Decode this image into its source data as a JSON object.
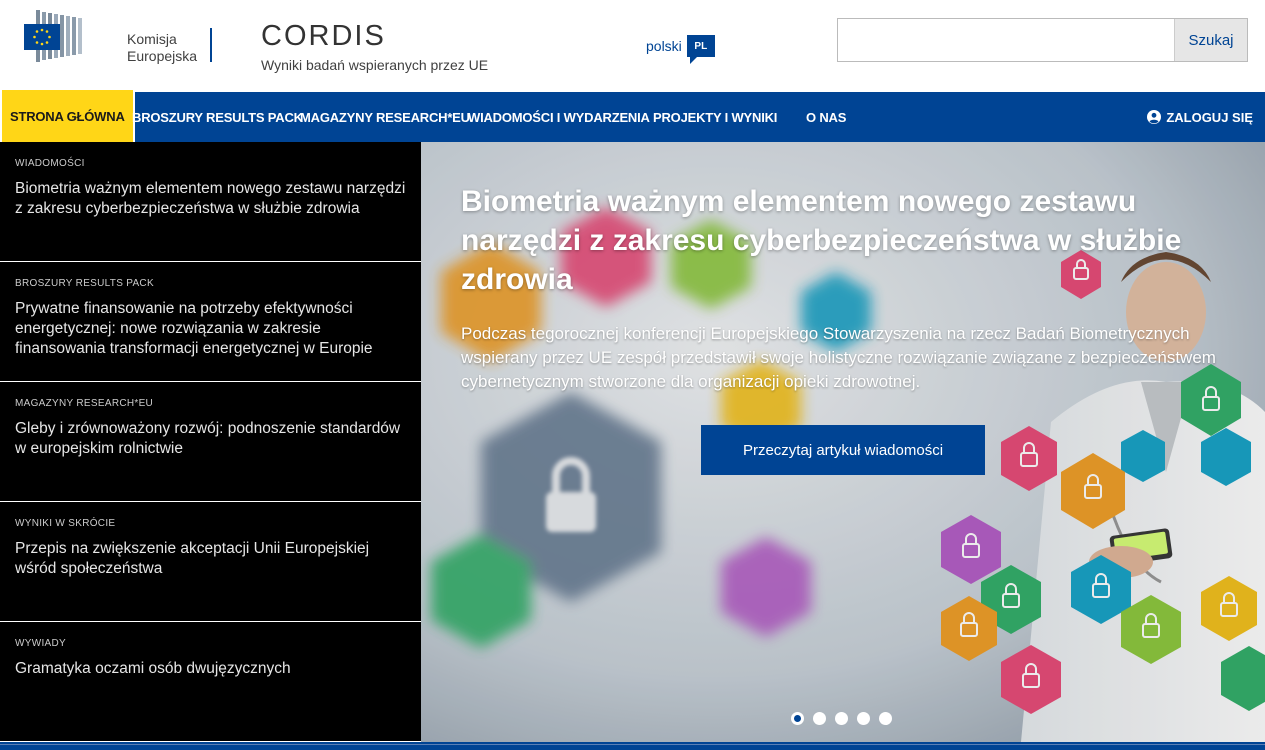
{
  "header": {
    "org_name_line1": "Komisja",
    "org_name_line2": "Europejska",
    "site_name": "CORDIS",
    "site_subtitle": "Wyniki badań wspieranych przez UE",
    "language_label": "polski",
    "language_code": "PL",
    "search": {
      "placeholder": "",
      "value": "",
      "button_label": "Szukaj"
    }
  },
  "nav": {
    "items": [
      {
        "label": "STRONA GŁÓWNA",
        "active": true
      },
      {
        "label": "BROSZURY RESULTS PACK"
      },
      {
        "label": "MAGAZYNY RESEARCH*EU"
      },
      {
        "label": "WIADOMOŚCI I WYDARZENIA"
      },
      {
        "label": "PROJEKTY I WYNIKI"
      },
      {
        "label": "O NAS"
      }
    ],
    "login_label": "ZALOGUJ SIĘ",
    "login_icon": "user-icon"
  },
  "sidebar": {
    "items": [
      {
        "category": "WIADOMOŚCI",
        "title": "Biometria ważnym elementem nowego zestawu narzędzi z zakresu cyberbezpieczeństwa w służbie zdrowia"
      },
      {
        "category": "BROSZURY RESULTS PACK",
        "title": "Prywatne finansowanie na potrzeby efektywności energetycznej: nowe rozwiązania w zakresie finansowania transformacji energetycznej w Europie"
      },
      {
        "category": "MAGAZYNY RESEARCH*EU",
        "title": "Gleby i zrównoważony rozwój: podnoszenie standardów w europejskim rolnictwie"
      },
      {
        "category": "WYNIKI W SKRÓCIE",
        "title": "Przepis na zwiększenie akceptacji Unii Europejskiej wśród społeczeństwa"
      },
      {
        "category": "WYWIADY",
        "title": "Gramatyka oczami osób dwujęzycznych"
      }
    ]
  },
  "hero": {
    "title": "Biometria ważnym elementem nowego zestawu narzędzi z zakresu cyberbezpieczeństwa w służbie zdrowia",
    "text": "Podczas tegorocznej konferencji Europejskiego Stowarzyszenia na rzecz Badań Biometrycznych wspierany przez UE zespół przedstawił swoje holistyczne rozwiązanie związane z bezpieczeństwem cybernetycznym stworzone dla organizacji opieki zdrowotnej.",
    "button_label": "Przeczytaj artykuł wiadomości",
    "slides_total": 5,
    "active_slide": 1
  },
  "colors": {
    "brand_blue": "#004494",
    "active_yellow": "#ffd617",
    "sidebar_bg": "#000000"
  }
}
